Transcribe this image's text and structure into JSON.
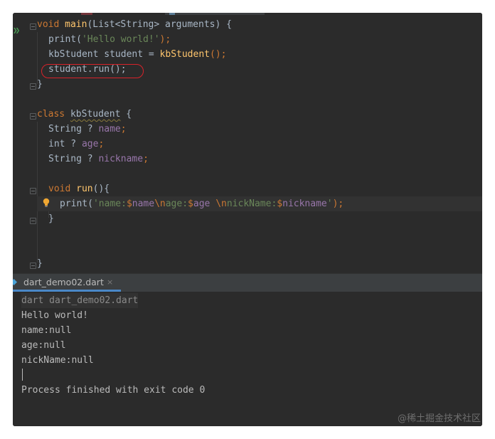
{
  "editor": {
    "code": {
      "main_sig": {
        "void": "void",
        "name": "main",
        "params": "(List<String> arguments) {"
      },
      "print_hello": {
        "fn": "print(",
        "str": "'Hello world!'",
        "end": ");"
      },
      "decl": {
        "type_and_var": "kbStudent student = ",
        "ctor": "kbStudent",
        "end": "();"
      },
      "run_call": "student.run();",
      "close_main": "}",
      "class_decl": {
        "kw": "class",
        "name": "kbStudent",
        "brace": " {"
      },
      "field_name": {
        "type": "String ? ",
        "name": "name",
        "semi": ";"
      },
      "field_age": {
        "type": "int ? ",
        "name": "age",
        "semi": ";"
      },
      "field_nickname": {
        "type": "String ? ",
        "name": "nickname",
        "semi": ";"
      },
      "run_sig": {
        "void": "void",
        "name": "run",
        "rest": "(){"
      },
      "print_fields": {
        "fn": "print(",
        "q1": "'name:",
        "d1": "$",
        "v1": "name",
        "e1": "\\n",
        "s2": "age:",
        "d2": "$",
        "v2": "age",
        "s3": " ",
        "e2": "\\n",
        "s4": "nickName:",
        "d3": "$",
        "v3": "nickname",
        "q2": "'",
        "end": ");"
      },
      "close_run": "}",
      "close_class": "}"
    }
  },
  "run_panel": {
    "tab_label": "dart_demo02.dart",
    "tab_close": "×",
    "console": {
      "command": "dart dart_demo02.dart",
      "lines": [
        "Hello world!",
        "name:null",
        "age:null",
        "nickName:null"
      ],
      "exit": "Process finished with exit code 0"
    }
  },
  "watermark": "@稀土掘金技术社区",
  "icons": {
    "run": "run-gutter-icon",
    "bulb": "intention-bulb-icon",
    "dart": "dart-file-icon"
  },
  "colors": {
    "keyword": "#cc7832",
    "function": "#ffc66d",
    "string": "#6a8759",
    "field": "#9876aa",
    "text": "#a9b7c6",
    "highlight_oval": "#d9222a",
    "tab_underline": "#4a88c7"
  }
}
